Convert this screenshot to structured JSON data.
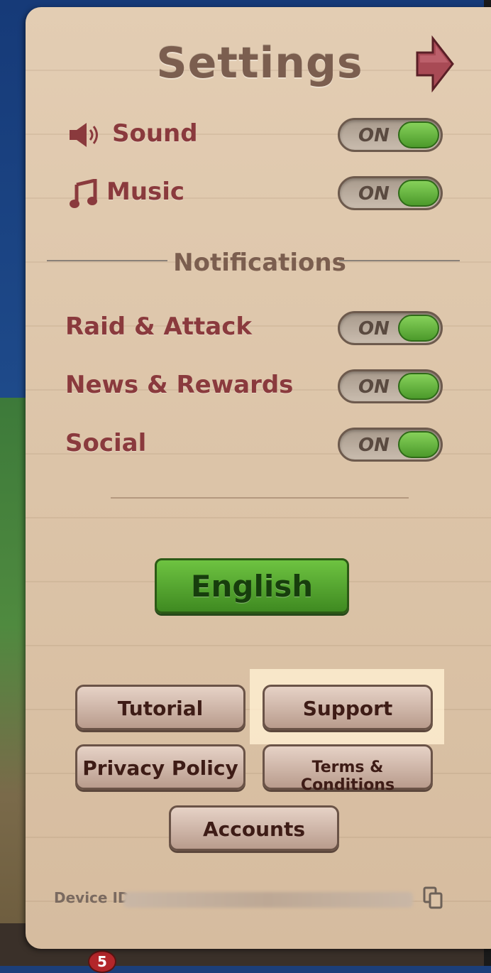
{
  "title": "Settings",
  "sound": {
    "label": "Sound",
    "toggle": "ON"
  },
  "music": {
    "label": "Music",
    "toggle": "ON"
  },
  "notifications": {
    "title": "Notifications",
    "items": [
      {
        "label": "Raid & Attack",
        "toggle": "ON"
      },
      {
        "label": "News & Rewards",
        "toggle": "ON"
      },
      {
        "label": "Social",
        "toggle": "ON"
      }
    ]
  },
  "language_button": "English",
  "buttons": {
    "tutorial": "Tutorial",
    "support": "Support",
    "privacy": "Privacy Policy",
    "terms": "Terms & Conditions",
    "accounts": "Accounts"
  },
  "device": {
    "label": "Device ID:"
  },
  "bottom_bar": {
    "badge_count": "5"
  },
  "colors": {
    "panel": "#dcc4a8",
    "label": "#8a3a3d",
    "toggle_on": "#5fb43a",
    "language_button": "#4f9a2b",
    "highlight": "#fff0d2"
  },
  "icons": [
    "speaker-icon",
    "music-note-icon",
    "close-arrow-icon",
    "copy-icon"
  ]
}
